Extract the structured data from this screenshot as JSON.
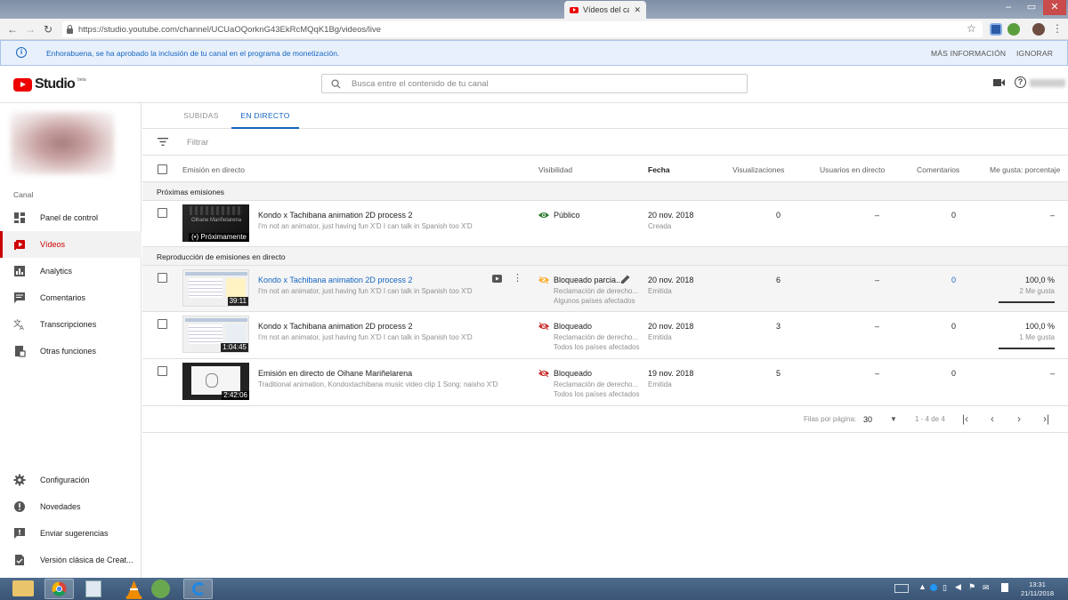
{
  "browser": {
    "tab_title": "Vídeos del canal",
    "url": "https://studio.youtube.com/channel/UCUaOQorknG43EkRcMQqK1Bg/videos/live"
  },
  "banner": {
    "message": "Enhorabuena, se ha aprobado la inclusión de tu canal en el programa de monetización.",
    "more_info": "MÁS INFORMACIÓN",
    "ignore": "IGNORAR"
  },
  "header": {
    "logo_text": "Studio",
    "logo_beta": "beta",
    "search_placeholder": "Busca entre el contenido de tu canal"
  },
  "sidebar": {
    "section_label": "Canal",
    "items": [
      {
        "label": "Panel de control",
        "icon": "dashboard-icon"
      },
      {
        "label": "Vídeos",
        "icon": "videos-icon",
        "active": true
      },
      {
        "label": "Analytics",
        "icon": "analytics-icon"
      },
      {
        "label": "Comentarios",
        "icon": "comments-icon"
      },
      {
        "label": "Transcripciones",
        "icon": "translate-icon"
      },
      {
        "label": "Otras funciones",
        "icon": "other-features-icon"
      }
    ],
    "bottom_items": [
      {
        "label": "Configuración",
        "icon": "gear-icon"
      },
      {
        "label": "Novedades",
        "icon": "alert-icon"
      },
      {
        "label": "Enviar sugerencias",
        "icon": "feedback-icon"
      },
      {
        "label": "Versión clásica de Creat...",
        "icon": "classic-icon"
      }
    ]
  },
  "tabs": [
    {
      "label": "SUBIDAS"
    },
    {
      "label": "EN DIRECTO",
      "active": true
    }
  ],
  "filter_placeholder": "Filtrar",
  "table": {
    "headers": {
      "stream": "Emisión en directo",
      "visibility": "Visibilidad",
      "date": "Fecha",
      "views": "Visualizaciones",
      "live_users": "Usuarios en directo",
      "comments": "Comentarios",
      "likes": "Me gusta: porcentaje"
    },
    "sections": [
      {
        "label": "Próximas emisiones"
      },
      {
        "label": "Reproducción de emisiones en directo"
      }
    ],
    "rows": [
      {
        "title": "Kondo x Tachibana animation 2D process 2",
        "desc": "I'm not an animator, just having fun X'D I can talk in Spanish too X'D",
        "thumb_badge": "(•) Próximamente",
        "thumb_caption": "Oihane Mariñelarena",
        "visibility": "Público",
        "vis_sub1": "",
        "vis_sub2": "",
        "date": "20 nov. 2018",
        "date_sub": "Creada",
        "views": "0",
        "live_users": "–",
        "comments": "0",
        "likes": "–",
        "likes_sub": ""
      },
      {
        "title": "Kondo x Tachibana animation 2D process 2",
        "desc": "I'm not an animator, just having fun X'D I can talk in Spanish too X'D",
        "duration": "39:11",
        "visibility": "Bloqueado parcia...",
        "vis_sub1": "Reclamación de derecho...",
        "vis_sub2": "Algunos países afectados",
        "date": "20 nov. 2018",
        "date_sub": "Emitida",
        "views": "6",
        "live_users": "–",
        "comments": "0",
        "likes": "100,0 %",
        "likes_sub": "2 Me gusta",
        "likes_fraction": 1.0
      },
      {
        "title": "Kondo x Tachibana animation 2D process 2",
        "desc": "I'm not an animator, just having fun X'D I can talk in Spanish too X'D",
        "duration": "1:04:45",
        "visibility": "Bloqueado",
        "vis_sub1": "Reclamación de derecho...",
        "vis_sub2": "Todos los países afectados",
        "date": "20 nov. 2018",
        "date_sub": "Emitida",
        "views": "3",
        "live_users": "–",
        "comments": "0",
        "likes": "100,0 %",
        "likes_sub": "1 Me gusta",
        "likes_fraction": 1.0
      },
      {
        "title": "Emisión en directo de Oihane Mariñelarena",
        "desc": "Traditional animation, Kondoxtachibana music video clip 1 Song: naisho X'D",
        "duration": "2:42:06",
        "visibility": "Bloqueado",
        "vis_sub1": "Reclamación de derecho...",
        "vis_sub2": "Todos los países afectados",
        "date": "19 nov. 2018",
        "date_sub": "Emitida",
        "views": "5",
        "live_users": "–",
        "comments": "0",
        "likes": "–",
        "likes_sub": ""
      }
    ]
  },
  "pagination": {
    "rows_label": "Filas por página:",
    "rows_value": "30",
    "range": "1 - 4 de 4"
  },
  "taskbar": {
    "time": "13:31",
    "date": "21/11/2018"
  },
  "colors": {
    "accent": "#1565c0",
    "brand_red": "#cc0000",
    "public_green": "#2e7d32",
    "blocked_red": "#c62828",
    "partial_orange": "#f9a825"
  }
}
